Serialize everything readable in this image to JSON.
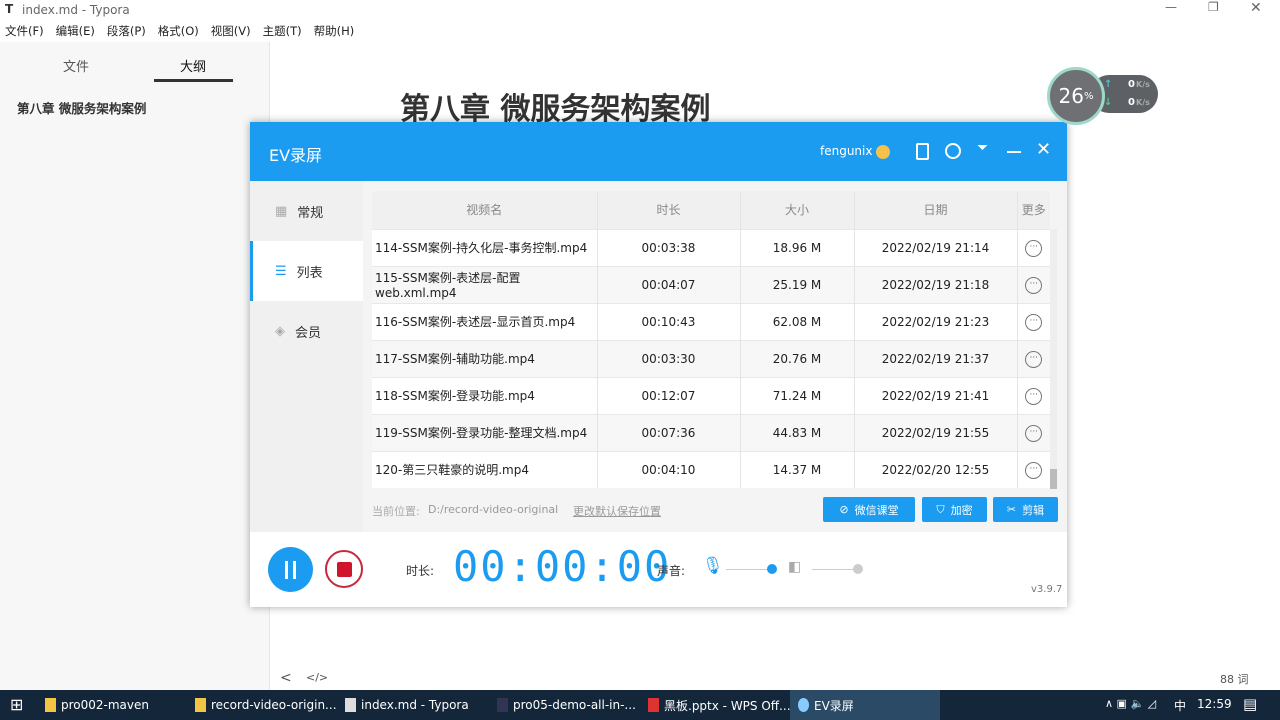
{
  "typora": {
    "title": "index.md - Typora",
    "menu": [
      "文件(F)",
      "编辑(E)",
      "段落(P)",
      "格式(O)",
      "视图(V)",
      "主题(T)",
      "帮助(H)"
    ],
    "sidebar_tabs": [
      "文件",
      "大纲"
    ],
    "outline": [
      "第八章 微服务架构案例"
    ],
    "heading": "第八章 微服务架构案例",
    "word_count": "88 词",
    "back": "<",
    "source": "</>"
  },
  "net_widget": {
    "cpu": "26",
    "unit": "%",
    "up": "0",
    "down": "0",
    "rate_unit": "K/s"
  },
  "ev": {
    "title": "EV录屏",
    "user": "fengunix",
    "nav": [
      "常规",
      "列表",
      "会员"
    ],
    "columns": [
      "视频名",
      "时长",
      "大小",
      "日期",
      "更多"
    ],
    "rows": [
      [
        "114-SSM案例-持久化层-事务控制.mp4",
        "00:03:38",
        "18.96 M",
        "2022/02/19 21:14"
      ],
      [
        "115-SSM案例-表述层-配置 web.xml.mp4",
        "00:04:07",
        "25.19 M",
        "2022/02/19 21:18"
      ],
      [
        "116-SSM案例-表述层-显示首页.mp4",
        "00:10:43",
        "62.08 M",
        "2022/02/19 21:23"
      ],
      [
        "117-SSM案例-辅助功能.mp4",
        "00:03:30",
        "20.76 M",
        "2022/02/19 21:37"
      ],
      [
        "118-SSM案例-登录功能.mp4",
        "00:12:07",
        "71.24 M",
        "2022/02/19 21:41"
      ],
      [
        "119-SSM案例-登录功能-整理文档.mp4",
        "00:07:36",
        "44.83 M",
        "2022/02/19 21:55"
      ],
      [
        "120-第三只鞋豪的说明.mp4",
        "00:04:10",
        "14.37 M",
        "2022/02/20 12:55"
      ]
    ],
    "location_label": "当前位置:",
    "location": "D:/record-video-original",
    "change_location": "更改默认保存位置",
    "buttons": [
      "微信课堂",
      "加密",
      "剪辑"
    ],
    "duration_label": "时长:",
    "timer": "00:00:00",
    "sound_label": "声音:",
    "version": "v3.9.7",
    "mic_level": 0.9,
    "speaker_level": 1.0
  },
  "taskbar": {
    "items": [
      "pro002-maven",
      "record-video-origin...",
      "index.md - Typora",
      "pro05-demo-all-in-...",
      "黑板.pptx - WPS Off...",
      "EV录屏"
    ],
    "time": "12:59",
    "ime": "中"
  }
}
